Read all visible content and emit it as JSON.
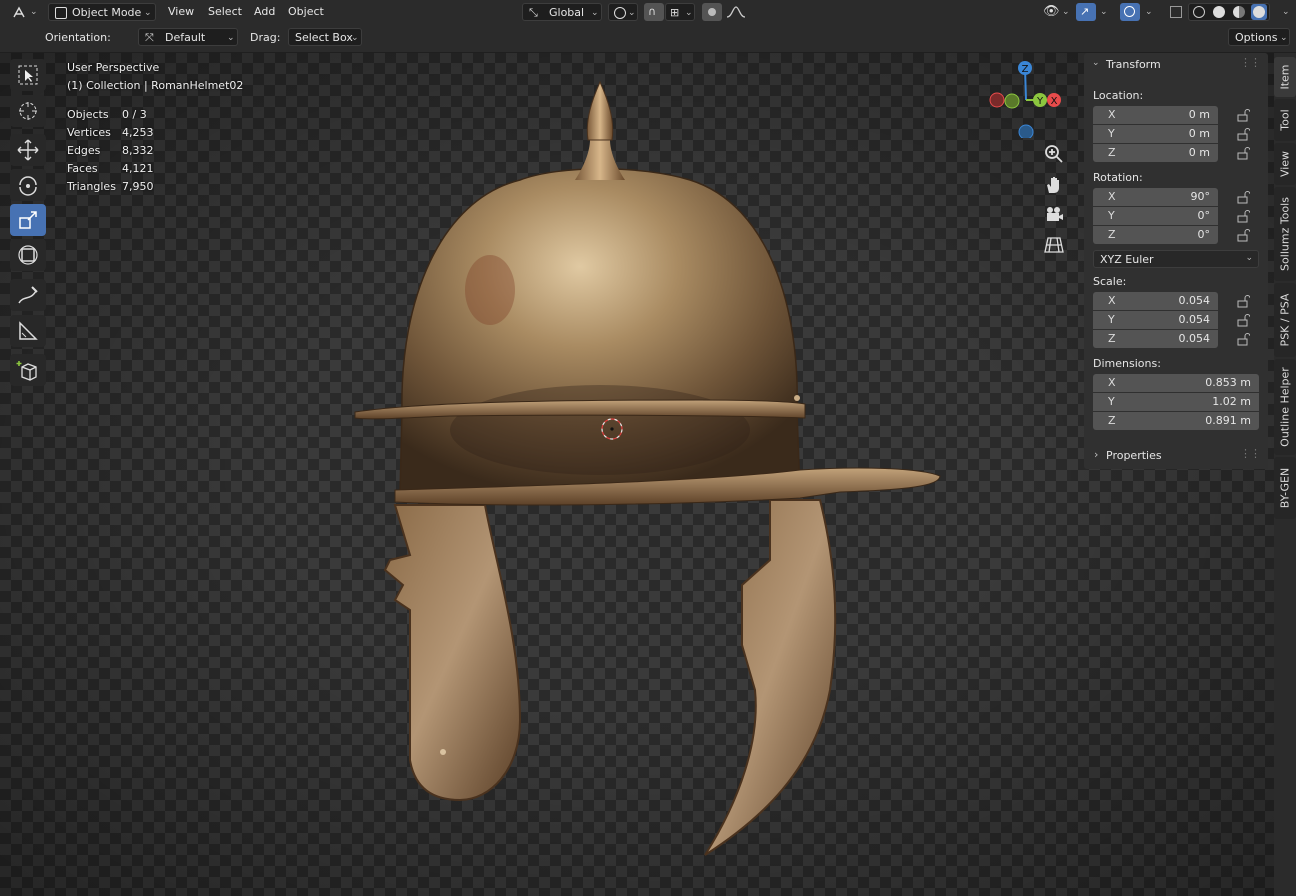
{
  "header": {
    "mode": "Object Mode",
    "menus": [
      "View",
      "Select",
      "Add",
      "Object"
    ],
    "transform_orientation": "Global"
  },
  "tool_header": {
    "orientation_label": "Orientation:",
    "orientation_value": "Default",
    "drag_label": "Drag:",
    "drag_value": "Select Box",
    "options_label": "Options"
  },
  "viewport": {
    "perspective": "User Perspective",
    "collection": "(1) Collection | RomanHelmet02",
    "stats": [
      {
        "label": "Objects",
        "value": "0 / 3"
      },
      {
        "label": "Vertices",
        "value": "4,253"
      },
      {
        "label": "Edges",
        "value": "8,332"
      },
      {
        "label": "Faces",
        "value": "4,121"
      },
      {
        "label": "Triangles",
        "value": "7,950"
      }
    ],
    "gizmo": {
      "x": "X",
      "y": "Y",
      "z": "Z"
    }
  },
  "toolbar": [
    "select-box-icon",
    "cursor-icon",
    "move-icon",
    "rotate-icon",
    "scale-icon",
    "transform-icon",
    "annotate-icon",
    "measure-icon",
    "add-cube-icon"
  ],
  "npanel": {
    "transform_title": "Transform",
    "location_label": "Location:",
    "location": [
      {
        "axis": "X",
        "value": "0 m"
      },
      {
        "axis": "Y",
        "value": "0 m"
      },
      {
        "axis": "Z",
        "value": "0 m"
      }
    ],
    "rotation_label": "Rotation:",
    "rotation": [
      {
        "axis": "X",
        "value": "90°"
      },
      {
        "axis": "Y",
        "value": "0°"
      },
      {
        "axis": "Z",
        "value": "0°"
      }
    ],
    "rotation_mode": "XYZ Euler",
    "scale_label": "Scale:",
    "scale": [
      {
        "axis": "X",
        "value": "0.054"
      },
      {
        "axis": "Y",
        "value": "0.054"
      },
      {
        "axis": "Z",
        "value": "0.054"
      }
    ],
    "dimensions_label": "Dimensions:",
    "dimensions": [
      {
        "axis": "X",
        "value": "0.853 m"
      },
      {
        "axis": "Y",
        "value": "1.02 m"
      },
      {
        "axis": "Z",
        "value": "0.891 m"
      }
    ],
    "properties_title": "Properties"
  },
  "side_tabs": [
    "Item",
    "Tool",
    "View",
    "Sollumz Tools",
    "PSK / PSA",
    "Outline Helper",
    "BY-GEN"
  ],
  "colors": {
    "accent": "#4772b3",
    "x_axis": "#e84b4b",
    "y_axis": "#8cc63f",
    "z_axis": "#3a86d6"
  }
}
